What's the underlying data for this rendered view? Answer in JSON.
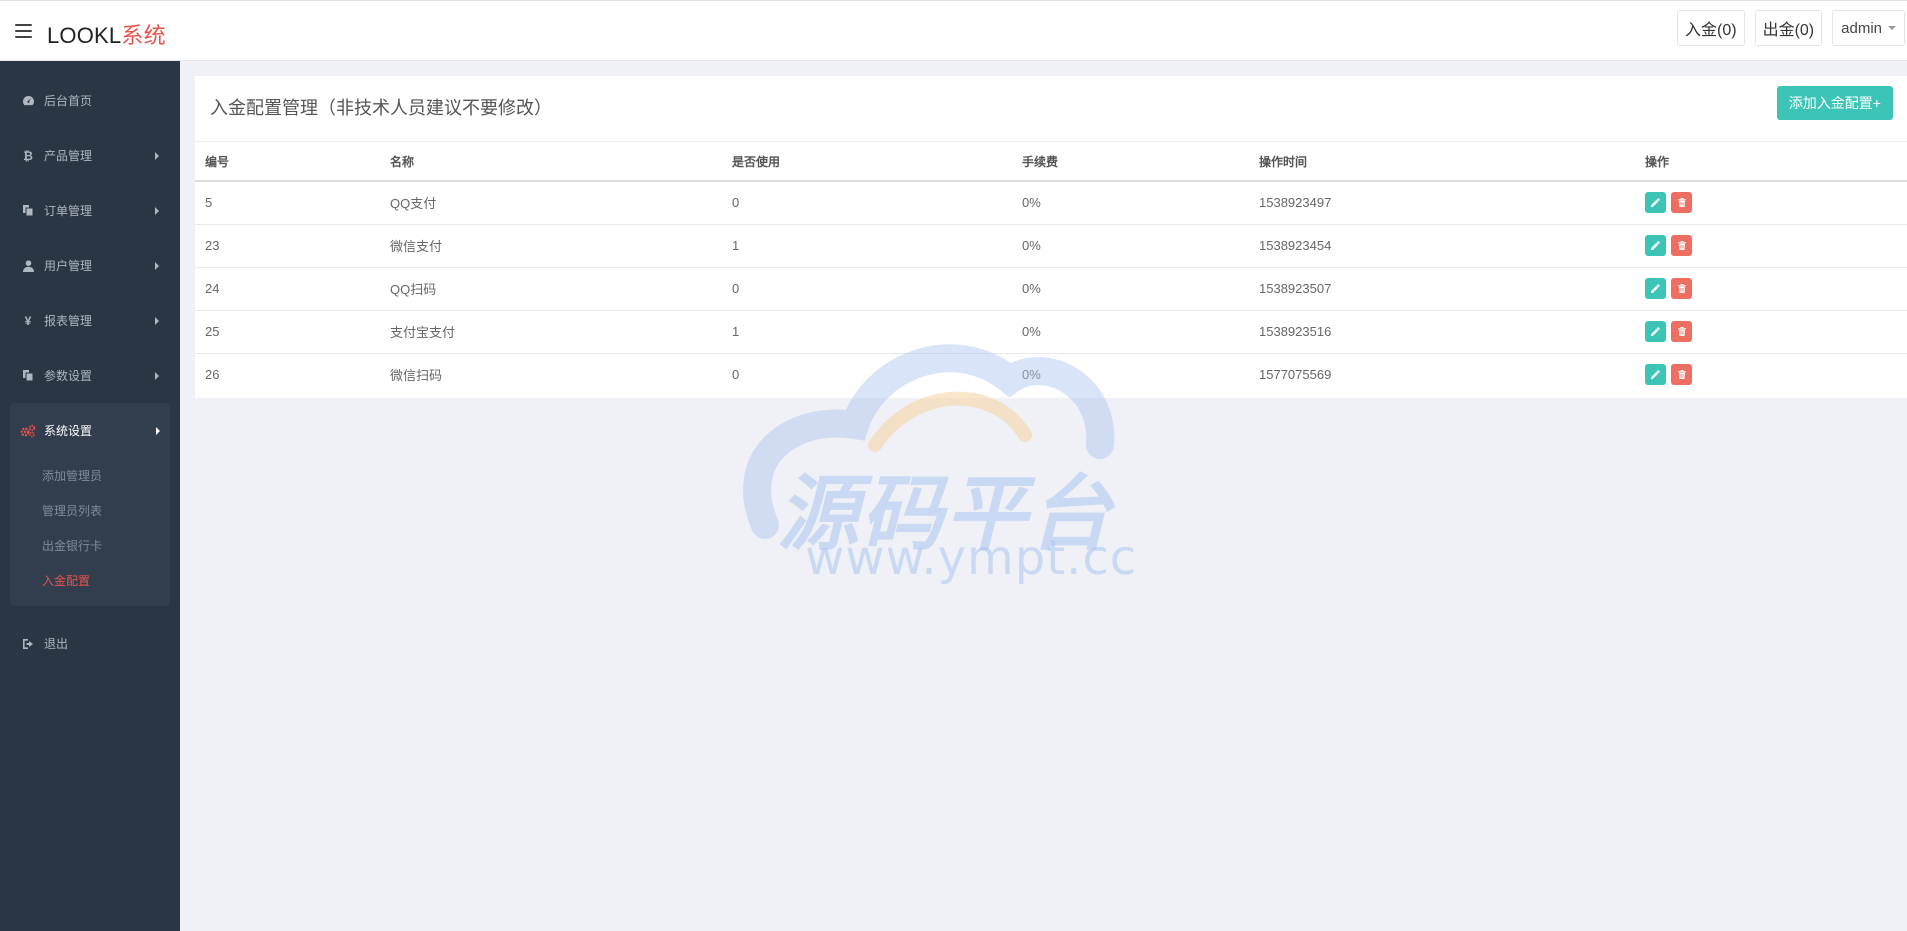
{
  "header": {
    "brand_main": "LOOKL",
    "brand_accent": "系统",
    "deposit_btn": "入金(0)",
    "withdraw_btn": "出金(0)",
    "user_label": "admin"
  },
  "sidebar": {
    "items": [
      {
        "label": "后台首页",
        "icon": "dashboard-icon"
      },
      {
        "label": "产品管理",
        "icon": "bitcoin-icon"
      },
      {
        "label": "订单管理",
        "icon": "copy-icon"
      },
      {
        "label": "用户管理",
        "icon": "user-icon"
      },
      {
        "label": "报表管理",
        "icon": "yen-icon"
      },
      {
        "label": "参数设置",
        "icon": "copy-icon"
      }
    ],
    "group": {
      "label": "系统设置",
      "icon": "cogs-icon",
      "subitems": [
        "添加管理员",
        "管理员列表",
        "出金银行卡",
        "入金配置"
      ],
      "active": "入金配置"
    },
    "logout": "退出"
  },
  "panel": {
    "title": "入金配置管理（非技术人员建议不要修改）",
    "add_button": "添加入金配置+",
    "columns": [
      "编号",
      "名称",
      "是否使用",
      "手续费",
      "操作时间",
      "操作"
    ],
    "rows": [
      {
        "id": "5",
        "name": "QQ支付",
        "enabled": "0",
        "fee": "0%",
        "time": "1538923497"
      },
      {
        "id": "23",
        "name": "微信支付",
        "enabled": "1",
        "fee": "0%",
        "time": "1538923454"
      },
      {
        "id": "24",
        "name": "QQ扫码",
        "enabled": "0",
        "fee": "0%",
        "time": "1538923507"
      },
      {
        "id": "25",
        "name": "支付宝支付",
        "enabled": "1",
        "fee": "0%",
        "time": "1538923516"
      },
      {
        "id": "26",
        "name": "微信扫码",
        "enabled": "0",
        "fee": "0%",
        "time": "1577075569"
      }
    ]
  },
  "watermark": {
    "text": "源码平台",
    "url": "www.ympt.cc"
  },
  "colors": {
    "accent": "#e9524b",
    "teal": "#3cc5b7",
    "danger": "#ee6e62",
    "sidebar": "#2b3644"
  }
}
